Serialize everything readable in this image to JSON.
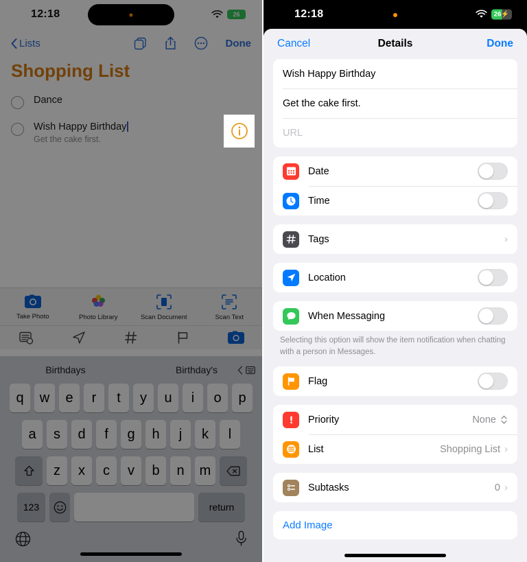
{
  "left": {
    "status": {
      "time": "12:18",
      "wifi_icon": "wifi-icon",
      "battery": "26"
    },
    "nav": {
      "back_label": "Lists",
      "back_icon": "chevron-left-icon",
      "copy_icon": "duplicate-icon",
      "share_icon": "share-icon",
      "more_icon": "ellipsis-circle-icon",
      "done_label": "Done"
    },
    "title": "Shopping List",
    "items": [
      {
        "title": "Dance",
        "subtitle": ""
      },
      {
        "title": "Wish Happy Birthday",
        "subtitle": "Get the cake first."
      }
    ],
    "highlight_icon": "info-circle-icon",
    "attachments": [
      {
        "label": "Take Photo",
        "icon": "camera-icon"
      },
      {
        "label": "Photo Library",
        "icon": "photos-icon"
      },
      {
        "label": "Scan Document",
        "icon": "scan-document-icon"
      },
      {
        "label": "Scan Text",
        "icon": "scan-text-icon"
      }
    ],
    "toolbar_icons": [
      "details-icon",
      "location-arrow-icon",
      "hashtag-icon",
      "flag-icon",
      "camera-icon"
    ],
    "keyboard": {
      "predictions": [
        "Birthdays",
        "Birthday's"
      ],
      "row1": [
        "q",
        "w",
        "e",
        "r",
        "t",
        "y",
        "u",
        "i",
        "o",
        "p"
      ],
      "row2": [
        "a",
        "s",
        "d",
        "f",
        "g",
        "h",
        "j",
        "k",
        "l"
      ],
      "row3": [
        "z",
        "x",
        "c",
        "v",
        "b",
        "n",
        "m"
      ],
      "shift_icon": "shift-icon",
      "backspace_icon": "backspace-icon",
      "num_label": "123",
      "emoji_icon": "emoji-icon",
      "space_label": "",
      "return_label": "return",
      "globe_icon": "globe-icon",
      "mic_icon": "microphone-icon"
    }
  },
  "right": {
    "status": {
      "time": "12:18",
      "wifi_icon": "wifi-icon",
      "battery": "26",
      "charging": "⚡"
    },
    "nav": {
      "cancel_label": "Cancel",
      "title": "Details",
      "done_label": "Done"
    },
    "fields": {
      "title_value": "Wish Happy Birthday",
      "notes_value": "Get the cake first.",
      "url_placeholder": "URL"
    },
    "rows": {
      "date": {
        "label": "Date",
        "icon": "calendar-icon",
        "color": "#ff3b30",
        "toggle": "off"
      },
      "time": {
        "label": "Time",
        "icon": "clock-icon",
        "color": "#007aff",
        "toggle": "off"
      },
      "tags": {
        "label": "Tags",
        "icon": "hashtag-icon",
        "color": "#4a4a4f",
        "value": ""
      },
      "location": {
        "label": "Location",
        "icon": "location-arrow-icon",
        "color": "#007aff",
        "toggle": "off"
      },
      "messaging": {
        "label": "When Messaging",
        "icon": "message-bubble-icon",
        "color": "#34c759",
        "toggle": "off"
      },
      "messaging_note": "Selecting this option will show the item notification when chatting with a person in Messages.",
      "flag": {
        "label": "Flag",
        "icon": "flag-icon",
        "color": "#ff9500",
        "toggle": "off"
      },
      "priority": {
        "label": "Priority",
        "icon": "exclamation-icon",
        "color": "#ff3b30",
        "value": "None"
      },
      "list": {
        "label": "List",
        "icon": "list-bullet-icon",
        "color": "#ff9500",
        "value": "Shopping List"
      },
      "subtasks": {
        "label": "Subtasks",
        "icon": "subtasks-icon",
        "color": "#a1845c",
        "value": "0"
      }
    },
    "add_image_label": "Add Image"
  }
}
